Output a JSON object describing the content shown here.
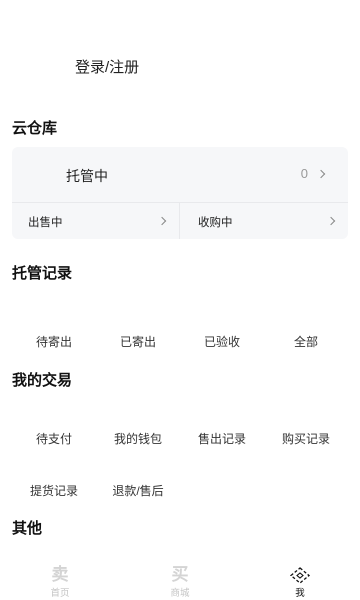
{
  "login": {
    "label": "登录/注册"
  },
  "cloud_warehouse": {
    "title": "云仓库",
    "hosting": {
      "label": "托管中",
      "count": "0"
    },
    "selling": {
      "label": "出售中"
    },
    "purchasing": {
      "label": "收购中"
    }
  },
  "hosting_records": {
    "title": "托管记录",
    "items": [
      "待寄出",
      "已寄出",
      "已验收",
      "全部"
    ]
  },
  "my_trades": {
    "title": "我的交易",
    "items": [
      "待支付",
      "我的钱包",
      "售出记录",
      "购买记录",
      "提货记录",
      "退款/售后"
    ]
  },
  "other": {
    "title": "其他"
  },
  "tabbar": {
    "items": [
      {
        "glyph": "卖",
        "label": "首页",
        "active": false
      },
      {
        "glyph": "买",
        "label": "商城",
        "active": false
      },
      {
        "icon": "profile-diamond-icon",
        "label": "我",
        "active": true
      }
    ]
  }
}
